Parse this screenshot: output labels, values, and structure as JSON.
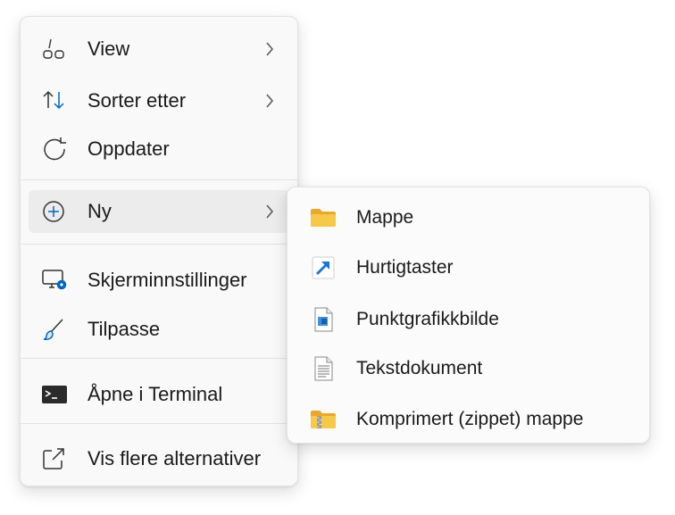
{
  "main_menu": {
    "items": [
      {
        "label": "View",
        "icon": "view-icon",
        "has_submenu": true
      },
      {
        "label": "Sorter etter",
        "icon": "sort-icon",
        "has_submenu": true
      },
      {
        "label": "Oppdater",
        "icon": "refresh-icon",
        "has_submenu": false
      },
      {
        "label": "Ny",
        "icon": "new-plus-icon",
        "has_submenu": true,
        "active": true
      },
      {
        "label": "Skjerminnstillinger",
        "icon": "display-settings-icon",
        "has_submenu": false
      },
      {
        "label": "Tilpasse",
        "icon": "brush-icon",
        "has_submenu": false
      },
      {
        "label": "Åpne i Terminal",
        "icon": "terminal-icon",
        "has_submenu": false
      },
      {
        "label": "Vis flere alternativer",
        "icon": "more-options-icon",
        "has_submenu": false
      }
    ]
  },
  "sub_menu": {
    "items": [
      {
        "label": "Mappe",
        "icon": "folder-icon"
      },
      {
        "label": "Hurtigtaster",
        "icon": "shortcut-icon"
      },
      {
        "label": "Punktgrafikkbilde",
        "icon": "bitmap-image-icon"
      },
      {
        "label": "Tekstdokument",
        "icon": "text-document-icon"
      },
      {
        "label": "Komprimert (zippet) mappe",
        "icon": "zip-folder-icon"
      }
    ]
  },
  "colors": {
    "accent": "#0067c0",
    "folder": "#f4c33d",
    "menu_bg": "#f9f9f9",
    "active_bg": "#ececec"
  }
}
